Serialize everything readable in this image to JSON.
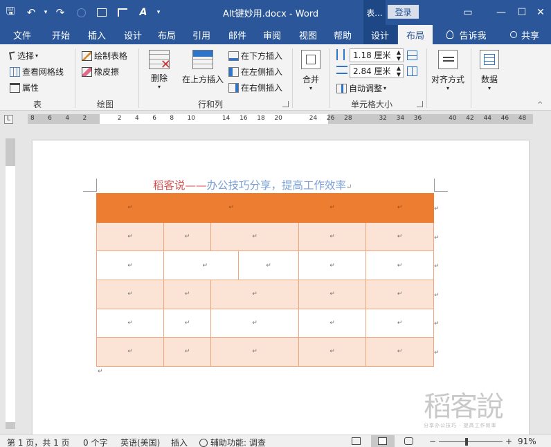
{
  "titlebar": {
    "doc_title": "Alt键妙用.docx  -  Word",
    "ctx_label": "表...",
    "login": "登录",
    "qat": {
      "save": "🖫",
      "undo": "↶",
      "undo_more": "▾",
      "redo": "↷",
      "more": "▾"
    },
    "winctl": {
      "ribbon_display": "▭",
      "minimize": "—",
      "restore": "☐",
      "close": "✕"
    }
  },
  "tabs": {
    "file": "文件",
    "home": "开始",
    "insert": "插入",
    "design": "设计",
    "layout": "布局",
    "references": "引用",
    "mailings": "邮件",
    "review": "审阅",
    "view": "视图",
    "help": "帮助",
    "table_design": "设计",
    "table_layout": "布局",
    "tellme": "告诉我",
    "share": "共享"
  },
  "ribbon": {
    "table": {
      "select": "选择",
      "view_gridlines": "查看网格线",
      "properties": "属性",
      "label": "表"
    },
    "draw": {
      "draw_table": "绘制表格",
      "eraser": "橡皮擦",
      "label": "绘图"
    },
    "rows_cols": {
      "delete": "删除",
      "insert_above": "在上方插入",
      "insert_below": "在下方插入",
      "insert_left": "在左侧插入",
      "insert_right": "在右侧插入",
      "label": "行和列"
    },
    "merge": {
      "merge": "合并"
    },
    "cell_size": {
      "height": "1.18 厘米",
      "width": "2.84 厘米",
      "autofit": "自动调整",
      "label": "单元格大小"
    },
    "alignment": {
      "label": "对齐方式"
    },
    "data": {
      "label": "数据"
    }
  },
  "ruler": {
    "marks_left": [
      "8",
      "6",
      "4",
      "2",
      "",
      "2",
      "4",
      "6",
      "8",
      "10",
      "",
      "14",
      "16",
      "18",
      "20",
      "",
      "24",
      "26",
      "28",
      "",
      "32",
      "34",
      "36",
      "",
      "40",
      "42",
      "44",
      "46",
      "48"
    ]
  },
  "document": {
    "heading_red": "稻客说——",
    "heading_blue": "办公技巧分享，提高工作效率",
    "para_mark": "↵"
  },
  "watermark": {
    "big": "稻客說",
    "small": "分享办公技巧 · 提高工作效率"
  },
  "statusbar": {
    "page": "第 1 页，共 1 页",
    "words": "0 个字",
    "language": "英语(美国)",
    "mode": "插入",
    "accessibility": "辅助功能: 调查",
    "zoom_minus": "−",
    "zoom_plus": "+",
    "zoom": "91%"
  },
  "colors": {
    "accent": "#2b579a",
    "table_header": "#ed7d31",
    "table_shade": "#fbe4d5",
    "table_border": "#f0a67a"
  }
}
